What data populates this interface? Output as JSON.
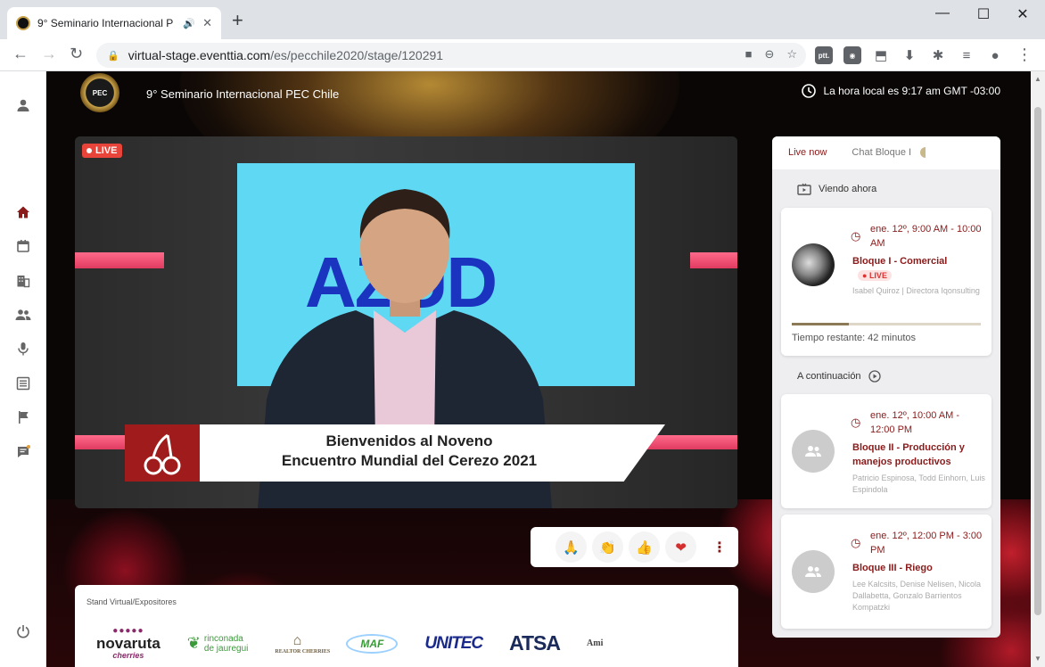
{
  "browser": {
    "tab_title": "9° Seminario Internacional P",
    "url_host": "virtual-stage.eventtia.com",
    "url_path": "/es/pecchile2020/stage/120291",
    "extensions": [
      "ptt."
    ]
  },
  "header": {
    "logo_text": "PEC",
    "event_title": "9° Seminario Internacional PEC Chile",
    "local_time": "La hora local es 9:17 am GMT -03:00"
  },
  "video": {
    "live_label": "LIVE",
    "screen_word": "AZUD",
    "lower_third_line1": "Bienvenidos al Noveno",
    "lower_third_line2": "Encuentro Mundial del Cerezo 2021"
  },
  "reactions": [
    "🙏",
    "👏",
    "👍",
    "❤"
  ],
  "stand": {
    "title": "Stand Virtual/Expositores",
    "logos": [
      "novaruta",
      "cherries",
      "rinconada",
      "de jauregui",
      "REALTOR CHERRIES",
      "MAF",
      "UNITEC",
      "ATSA",
      "Ami"
    ]
  },
  "panel": {
    "tabs": [
      "Live now",
      "Chat Bloque I"
    ],
    "now_heading": "Viendo ahora",
    "next_heading": "A continuación",
    "current": {
      "time": "ene. 12º, 9:00 AM - 10:00 AM",
      "title": "Bloque I - Comercial",
      "live": "LIVE",
      "speakers": "Isabel Quiroz | Directora Iqonsulting",
      "progress": 0.3,
      "remaining": "Tiempo restante: 42 minutos"
    },
    "upcoming": [
      {
        "time": "ene. 12º, 10:00 AM - 12:00 PM",
        "title": "Bloque II - Producción y manejos productivos",
        "speakers": "Patricio Espinosa, Todd Einhorn, Luis Espindola"
      },
      {
        "time": "ene. 12º, 12:00 PM - 3:00 PM",
        "title": "Bloque III - Riego",
        "speakers": "Lee Kalcsits, Denise Nelisen, Nicola Dallabetta, Gonzalo Barrientos Kompatzki"
      }
    ]
  },
  "colors": {
    "accent": "#8b1a1a",
    "live": "#e8443a"
  }
}
